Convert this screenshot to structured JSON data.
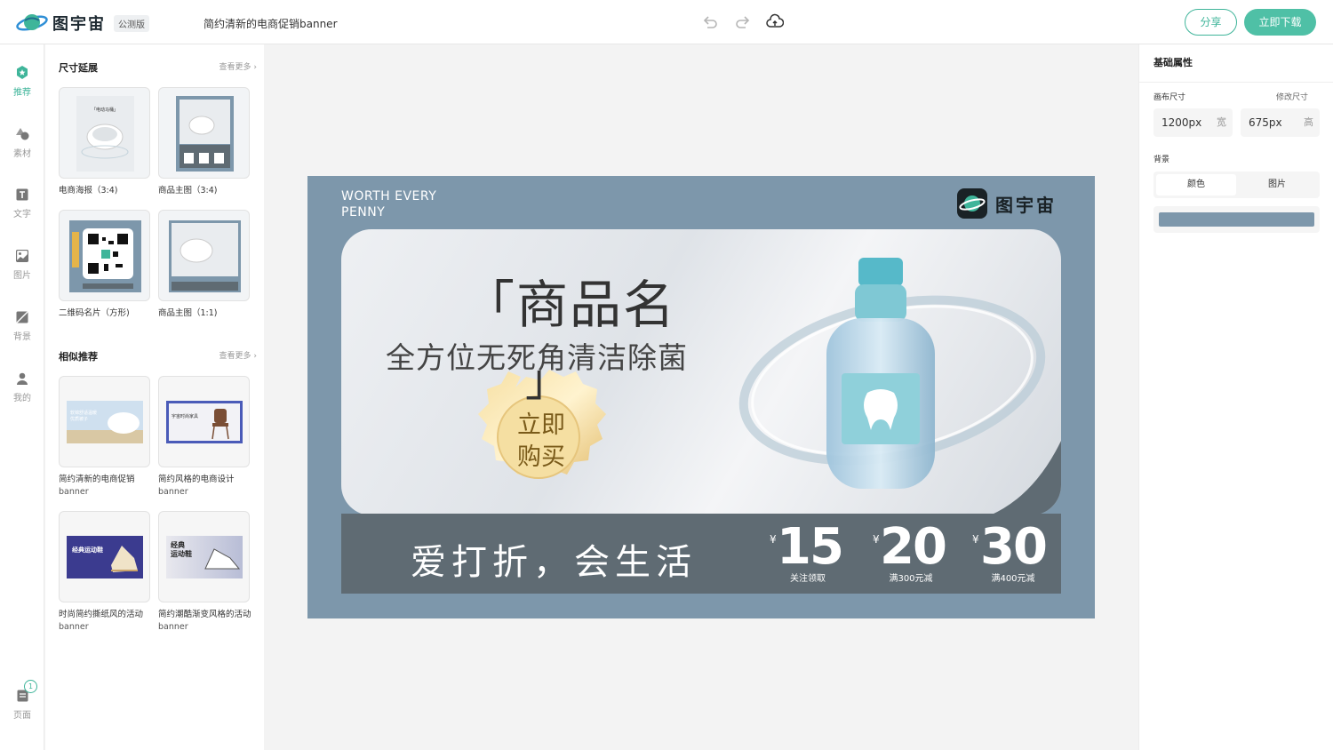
{
  "app": {
    "brand": "图宇宙",
    "edition_badge": "公测版",
    "document_title": "简约清新的电商促销banner",
    "share_label": "分享",
    "download_label": "立即下载",
    "accent_color": "#3fb59a"
  },
  "rail": {
    "items": [
      {
        "label": "推荐",
        "icon": "star-icon"
      },
      {
        "label": "素材",
        "icon": "shapes-icon"
      },
      {
        "label": "文字",
        "icon": "text-icon"
      },
      {
        "label": "图片",
        "icon": "image-icon"
      },
      {
        "label": "背景",
        "icon": "background-icon"
      },
      {
        "label": "我的",
        "icon": "user-icon"
      }
    ],
    "pages_label": "页面",
    "pages_count": "1"
  },
  "panel": {
    "size_section": {
      "title": "尺寸延展",
      "more": "查看更多",
      "cards": [
        {
          "label": "电商海报（3:4)"
        },
        {
          "label": "商品主图（3:4)"
        },
        {
          "label": "二维码名片（方形)"
        },
        {
          "label": "商品主图（1:1)"
        }
      ]
    },
    "similar_section": {
      "title": "相似推荐",
      "more": "查看更多",
      "cards": [
        {
          "label": "简约清新的电商促销",
          "sub": "banner"
        },
        {
          "label": "简约风格的电商设计",
          "sub": "banner"
        },
        {
          "label": "时尚简约撕纸风的活动",
          "sub": "banner"
        },
        {
          "label": "简约潮酷渐变风格的活动",
          "sub": "banner"
        }
      ]
    }
  },
  "banner": {
    "tagline_line1": "WORTH EVERY",
    "tagline_line2": "PENNY",
    "brand": "图宇宙",
    "title": "「商品名",
    "bracket_close": "」",
    "subtitle": "全方位无死角清洁除菌",
    "badge_line1": "立即",
    "badge_line2": "购买",
    "slogan": "爱打折，会生活",
    "coupons": [
      {
        "currency": "¥",
        "amount": "15",
        "caption": "关注领取"
      },
      {
        "currency": "¥",
        "amount": "20",
        "caption": "满300元减"
      },
      {
        "currency": "¥",
        "amount": "30",
        "caption": "满400元减"
      }
    ]
  },
  "properties": {
    "header": "基础属性",
    "canvas_size_label": "画布尺寸",
    "resize_link": "修改尺寸",
    "width_value": "1200px",
    "width_unit": "宽",
    "height_value": "675px",
    "height_unit": "高",
    "background_label": "背景",
    "tab_color": "颜色",
    "tab_image": "图片",
    "background_color": "#7d97ab"
  }
}
